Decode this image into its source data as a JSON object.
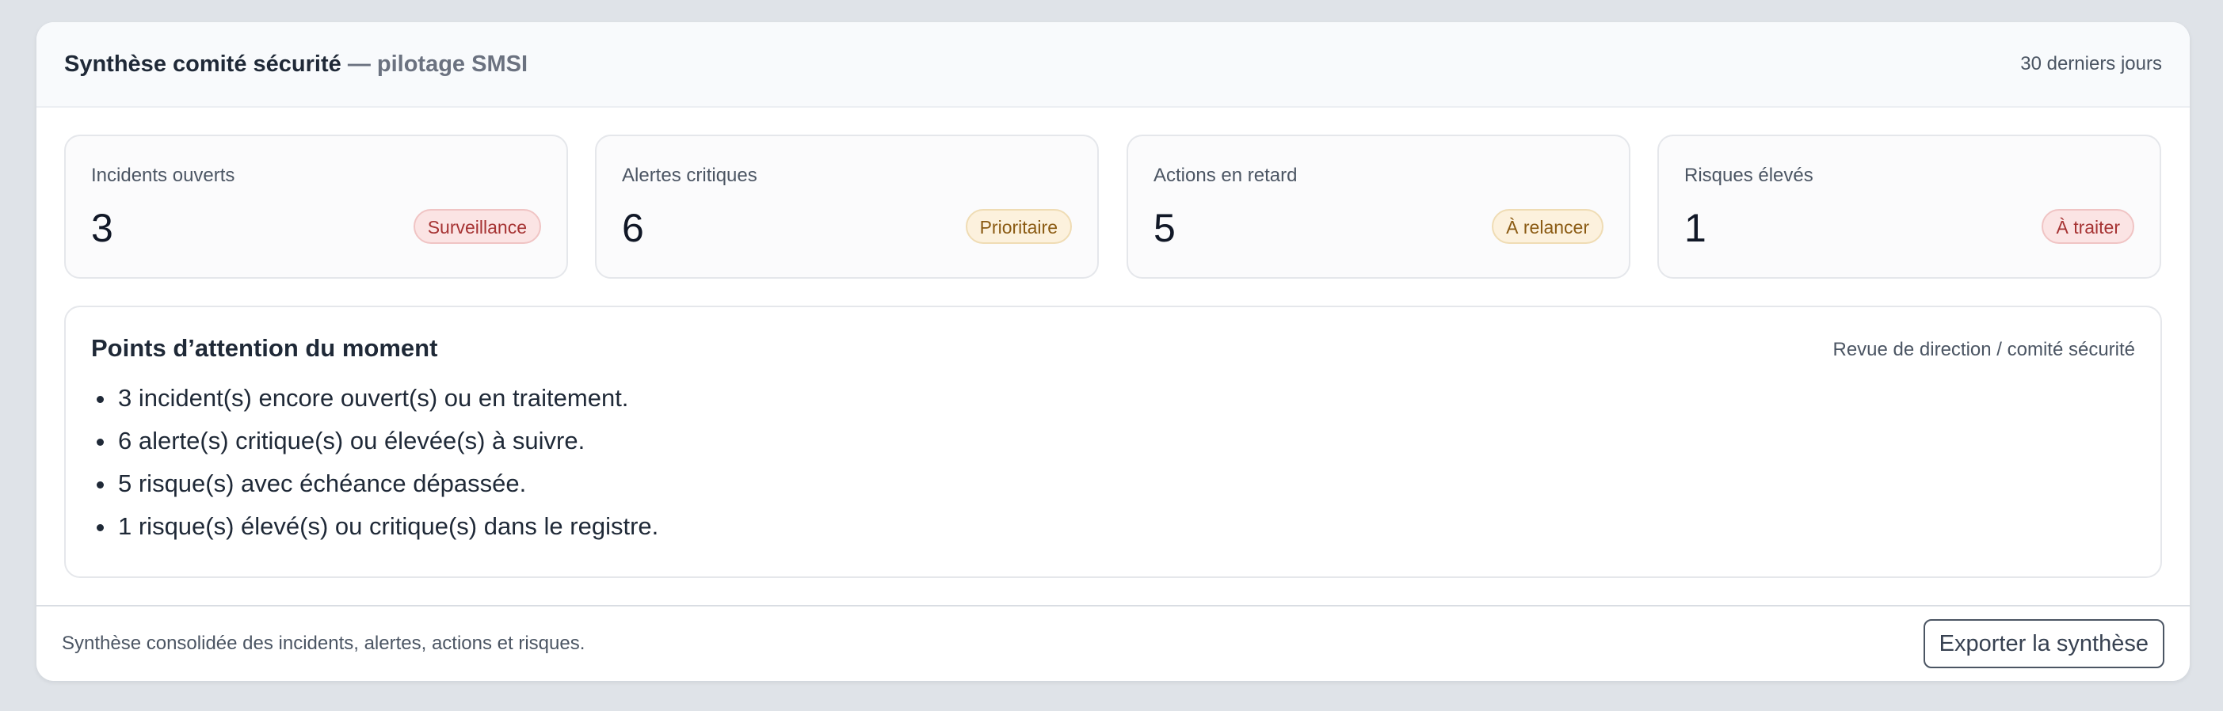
{
  "header": {
    "title": "Synthèse comité sécurité",
    "subtitle": " — pilotage SMSI",
    "period": "30 derniers jours"
  },
  "kpis": [
    {
      "label": "Incidents ouverts",
      "value": "3",
      "badge": "Surveillance",
      "tone": "red"
    },
    {
      "label": "Alertes critiques",
      "value": "6",
      "badge": "Prioritaire",
      "tone": "amber"
    },
    {
      "label": "Actions en retard",
      "value": "5",
      "badge": "À relancer",
      "tone": "amber"
    },
    {
      "label": "Risques élevés",
      "value": "1",
      "badge": "À traiter",
      "tone": "red"
    }
  ],
  "attention": {
    "title": "Points d’attention du moment",
    "context": "Revue de direction / comité sécurité",
    "items": [
      "3 incident(s) encore ouvert(s) ou en traitement.",
      "6 alerte(s) critique(s) ou élevée(s) à suivre.",
      "5 risque(s) avec échéance dépassée.",
      "1 risque(s) élevé(s) ou critique(s) dans le registre."
    ]
  },
  "footer": {
    "note": "Synthèse consolidée des incidents, alertes, actions et risques.",
    "export_label": "Exporter la synthèse"
  },
  "colors": {
    "page_background": "#dfe3e8",
    "badge_red_text": "#a63333",
    "badge_amber_text": "#8a5a12"
  }
}
